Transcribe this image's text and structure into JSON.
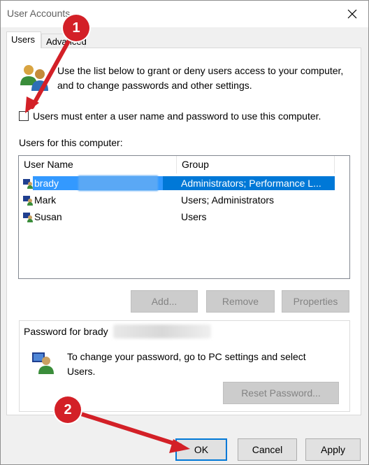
{
  "window": {
    "title": "User Accounts"
  },
  "tabs": [
    {
      "label": "Users"
    },
    {
      "label": "Advanced"
    }
  ],
  "intro_text": "Use the list below to grant or deny users access to your computer, and to change passwords and other settings.",
  "checkbox": {
    "label": "Users must enter a user name and password to use this computer.",
    "checked": false
  },
  "users_list": {
    "label": "Users for this computer:",
    "columns": [
      "User Name",
      "Group"
    ],
    "rows": [
      {
        "name": "brady",
        "group": "Administrators; Performance L...",
        "selected": true
      },
      {
        "name": "Mark",
        "group": "Users; Administrators",
        "selected": false
      },
      {
        "name": "Susan",
        "group": "Users",
        "selected": false
      }
    ]
  },
  "list_buttons": {
    "add": "Add...",
    "remove": "Remove",
    "properties": "Properties"
  },
  "password": {
    "legend": "Password for brady",
    "text": "To change your password, go to PC settings and select Users.",
    "reset_label": "Reset Password..."
  },
  "footer": {
    "ok": "OK",
    "cancel": "Cancel",
    "apply": "Apply"
  },
  "annotations": [
    {
      "label": "1"
    },
    {
      "label": "2"
    }
  ],
  "colors": {
    "selection": "#0078d7",
    "annotation": "#d32027"
  }
}
